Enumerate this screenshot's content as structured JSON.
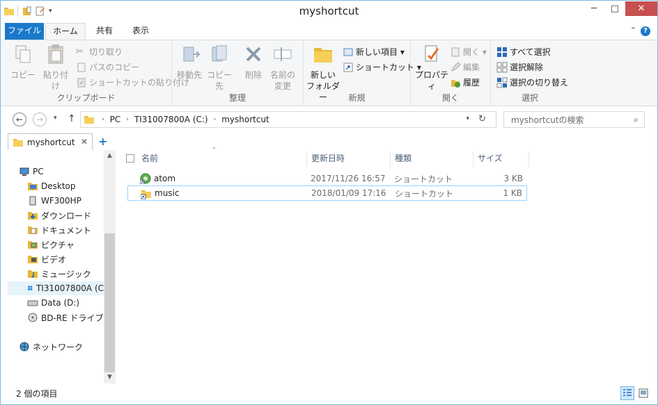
{
  "window": {
    "title": "myshortcut",
    "min": "─",
    "max": "□",
    "close": "✕"
  },
  "tabs": {
    "file": "ファイル",
    "home": "ホーム",
    "share": "共有",
    "view": "表示",
    "help": "?",
    "collapse": "⌃"
  },
  "ribbon": {
    "clipboard": {
      "label": "クリップボード",
      "copy": "コピー",
      "paste": "貼り付け",
      "cut": "切り取り",
      "copy_path": "パスのコピー",
      "paste_shortcut": "ショートカットの貼り付け"
    },
    "organize": {
      "label": "整理",
      "move_to": "移動先",
      "copy_to": "コピー先",
      "delete": "削除",
      "rename1": "名前の",
      "rename2": "変更"
    },
    "new": {
      "label": "新規",
      "new_folder1": "新しい",
      "new_folder2": "フォルダー",
      "new_item": "新しい項目 ▾",
      "easy_access": "ショートカット ▾"
    },
    "open": {
      "label": "開く",
      "properties": "プロパティ",
      "open": "開く ▾",
      "edit": "編集",
      "history": "履歴"
    },
    "select": {
      "label": "選択",
      "select_all": "すべて選択",
      "select_none": "選択解除",
      "invert": "選択の切り替え"
    }
  },
  "address": {
    "back": "←",
    "forward": "→",
    "recent": "▾",
    "up": "↑",
    "crumbs": [
      "PC",
      "TI31007800A (C:)",
      "myshortcut"
    ],
    "sep": "›",
    "refresh": "↻",
    "dropdown": "▾"
  },
  "search": {
    "placeholder": "myshortcutの検索",
    "icon": "⌕"
  },
  "navtab": {
    "label": "myshortcut",
    "close": "✕",
    "add": "+"
  },
  "tree": {
    "pc": "PC",
    "desktop": "Desktop",
    "wf": "WF300HP",
    "downloads": "ダウンロード",
    "documents": "ドキュメント",
    "pictures": "ピクチャ",
    "videos": "ビデオ",
    "music": "ミュージック",
    "c": "TI31007800A (C",
    "d": "Data (D:)",
    "bd": "BD-RE ドライブ (E",
    "network": "ネットワーク"
  },
  "columns": {
    "name": "名前",
    "date": "更新日時",
    "type": "種類",
    "size": "サイズ",
    "sort": "ˆ"
  },
  "files": [
    {
      "name": "atom",
      "date": "2017/11/26 16:57",
      "type": "ショートカット",
      "size": "3 KB"
    },
    {
      "name": "music",
      "date": "2018/01/09 17:16",
      "type": "ショートカット",
      "size": "1 KB"
    }
  ],
  "status": {
    "count": "2 個の項目"
  },
  "scroll": {
    "up": "▲",
    "down": "▼"
  }
}
